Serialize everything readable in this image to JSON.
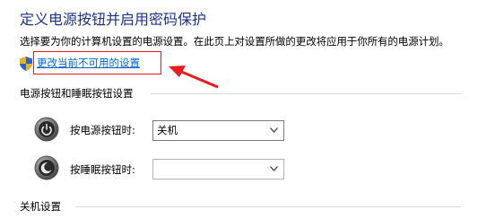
{
  "page": {
    "title": "定义电源按钮并启用密码保护",
    "description": "选择要为你的计算机设置的电源设置。在此页上对设置所做的更改将应用于你所有的电源计划。",
    "change_link": "更改当前不可用的设置"
  },
  "sections": {
    "power_buttons": "电源按钮和睡眠按钮设置",
    "shutdown": "关机设置"
  },
  "settings": {
    "power_button_label": "按电源按钮时:",
    "power_button_value": "关机",
    "sleep_button_label": "按睡眠按钮时:",
    "sleep_button_value": ""
  },
  "colors": {
    "title": "#1e3287",
    "link": "#0066cc",
    "annotation": "#e61e1e"
  }
}
